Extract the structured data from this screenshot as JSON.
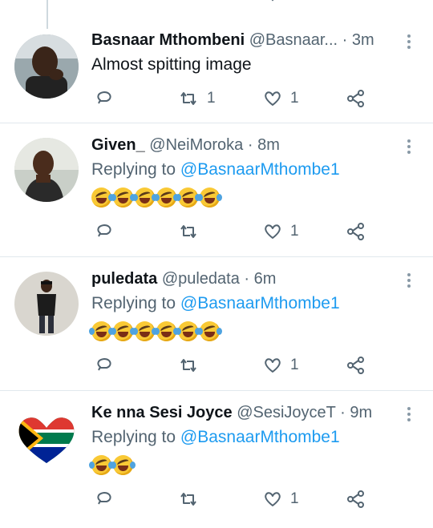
{
  "tweets": [
    {
      "name": "Basnaar Mthombeni",
      "handle": "@Basnaar...",
      "time": "3m",
      "text": "Almost spitting image",
      "replying_label": "",
      "replying_mention": "",
      "emojis": [],
      "reply_count": "",
      "retweet_count": "1",
      "like_count": "1",
      "avatar": "man-in-car-photo"
    },
    {
      "name": "Given_",
      "handle": "@NeiMoroka",
      "time": "8m",
      "text": "",
      "replying_label": "Replying to",
      "replying_mention": "@BasnaarMthombe1",
      "emojis": [
        "grinning-sweat",
        "rofl",
        "rofl",
        "rofl",
        "rofl",
        "rofl"
      ],
      "reply_count": "",
      "retweet_count": "",
      "like_count": "1",
      "avatar": "woman-selfie-photo"
    },
    {
      "name": "puledata",
      "handle": "@puledata",
      "time": "6m",
      "text": "",
      "replying_label": "Replying to",
      "replying_mention": "@BasnaarMthombe1",
      "emojis": [
        "rofl",
        "rofl",
        "rofl",
        "rofl",
        "rofl",
        "rofl"
      ],
      "reply_count": "",
      "retweet_count": "",
      "like_count": "1",
      "avatar": "man-standing-photo"
    },
    {
      "name": "Ke nna Sesi Joyce",
      "handle": "@SesiJoyceT",
      "time": "9m",
      "text": "",
      "replying_label": "Replying to",
      "replying_mention": "@BasnaarMthombe1",
      "emojis": [
        "rofl",
        "rofl"
      ],
      "reply_count": "",
      "retweet_count": "",
      "like_count": "1",
      "avatar": "south-africa-flag-heart"
    }
  ],
  "separator": "·",
  "colors": {
    "mention": "#1d9bf0",
    "secondary": "#536471",
    "divider": "#e1e8ed"
  }
}
